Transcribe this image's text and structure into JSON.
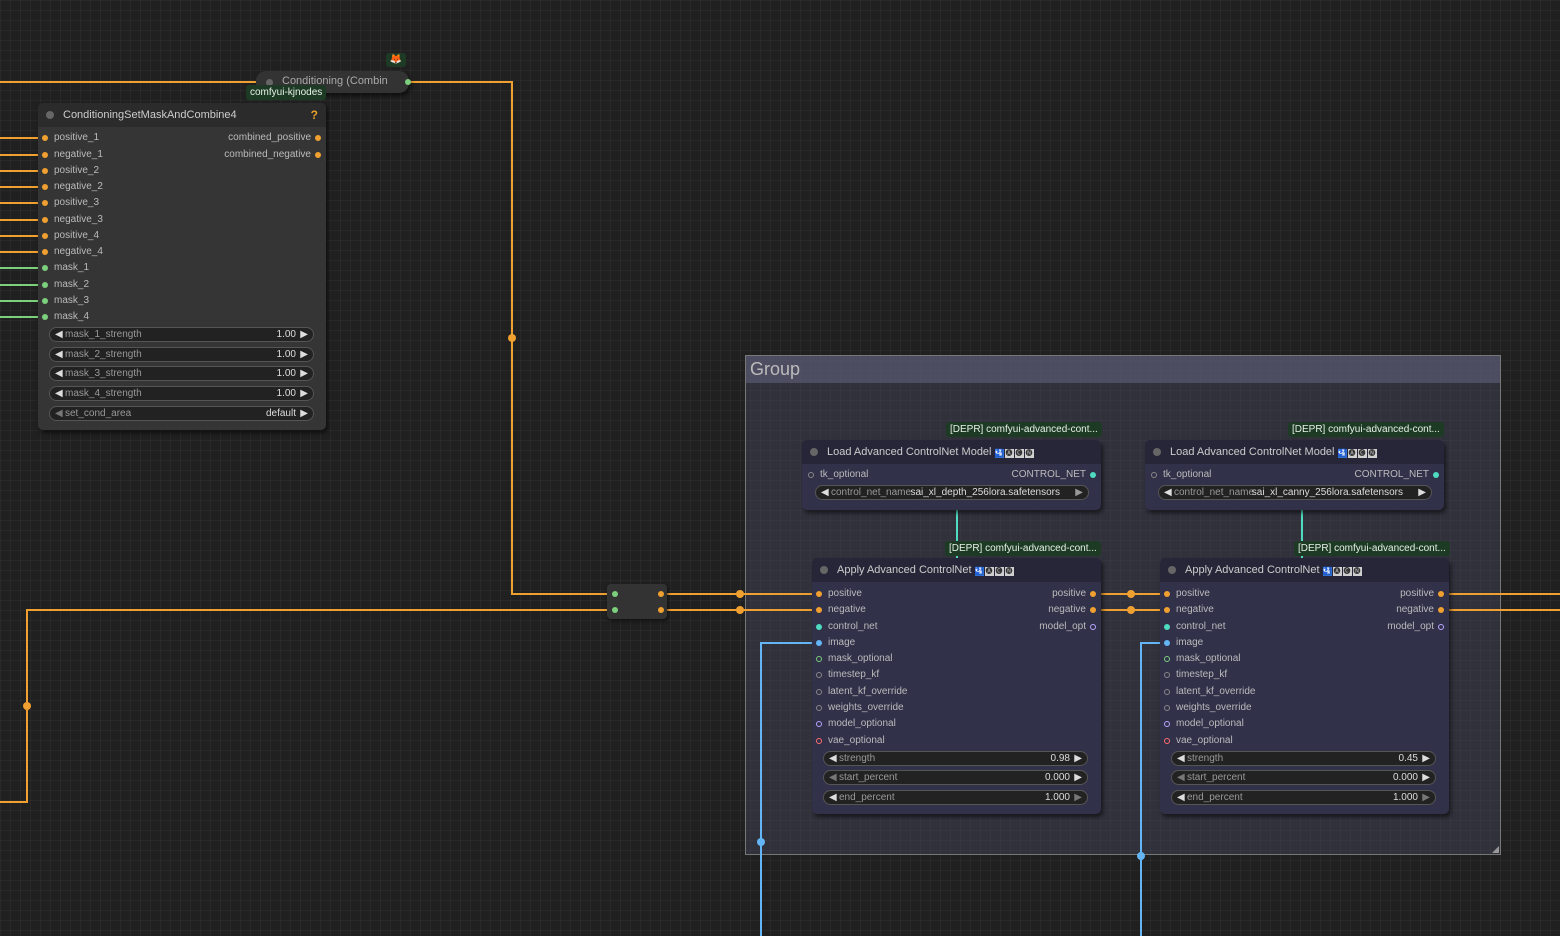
{
  "group": {
    "title": "Group"
  },
  "conditioning_collapsed": {
    "title": "Conditioning (Combin",
    "badge": "comfyui-kjnodes",
    "icon": "fox-icon"
  },
  "mask_combine": {
    "title": "ConditioningSetMaskAndCombine4",
    "help": "?",
    "inputs": [
      "positive_1",
      "negative_1",
      "positive_2",
      "negative_2",
      "positive_3",
      "negative_3",
      "positive_4",
      "negative_4",
      "mask_1",
      "mask_2",
      "mask_3",
      "mask_4"
    ],
    "outputs": [
      "combined_positive",
      "combined_negative"
    ],
    "widgets": [
      {
        "label": "mask_1_strength",
        "value": "1.00"
      },
      {
        "label": "mask_2_strength",
        "value": "1.00"
      },
      {
        "label": "mask_3_strength",
        "value": "1.00"
      },
      {
        "label": "mask_4_strength",
        "value": "1.00"
      },
      {
        "label": "set_cond_area",
        "value": "default"
      }
    ]
  },
  "loader_left": {
    "badge": "[DEPR] comfyui-advanced-cont...",
    "title": "Load Advanced ControlNet Model",
    "input": "tk_optional",
    "output": "CONTROL_NET",
    "widget": {
      "label": "control_net_name",
      "value": "sai_xl_depth_256lora.safetensors"
    }
  },
  "loader_right": {
    "badge": "[DEPR] comfyui-advanced-cont...",
    "title": "Load Advanced ControlNet Model",
    "input": "tk_optional",
    "output": "CONTROL_NET",
    "widget": {
      "label": "control_net_name",
      "value": "sai_xl_canny_256lora.safetensors"
    }
  },
  "apply_left": {
    "badge": "[DEPR] comfyui-advanced-cont...",
    "title": "Apply Advanced ControlNet",
    "inputs": [
      "positive",
      "negative",
      "control_net",
      "image",
      "mask_optional",
      "timestep_kf",
      "latent_kf_override",
      "weights_override",
      "model_optional",
      "vae_optional"
    ],
    "outputs": [
      "positive",
      "negative",
      "model_opt"
    ],
    "widgets": [
      {
        "label": "strength",
        "value": "0.98"
      },
      {
        "label": "start_percent",
        "value": "0.000"
      },
      {
        "label": "end_percent",
        "value": "1.000"
      }
    ]
  },
  "apply_right": {
    "badge": "[DEPR] comfyui-advanced-cont...",
    "title": "Apply Advanced ControlNet",
    "inputs": [
      "positive",
      "negative",
      "control_net",
      "image",
      "mask_optional",
      "timestep_kf",
      "latent_kf_override",
      "weights_override",
      "model_optional",
      "vae_optional"
    ],
    "outputs": [
      "positive",
      "negative",
      "model_opt"
    ],
    "widgets": [
      {
        "label": "strength",
        "value": "0.45"
      },
      {
        "label": "start_percent",
        "value": "0.000"
      },
      {
        "label": "end_percent",
        "value": "1.000"
      }
    ]
  },
  "colors": {
    "conditioning": "#f0a030",
    "mask": "#7ccf7c",
    "control_net": "#4fdbc0",
    "image": "#64b5f6",
    "canvas": "#202020"
  }
}
